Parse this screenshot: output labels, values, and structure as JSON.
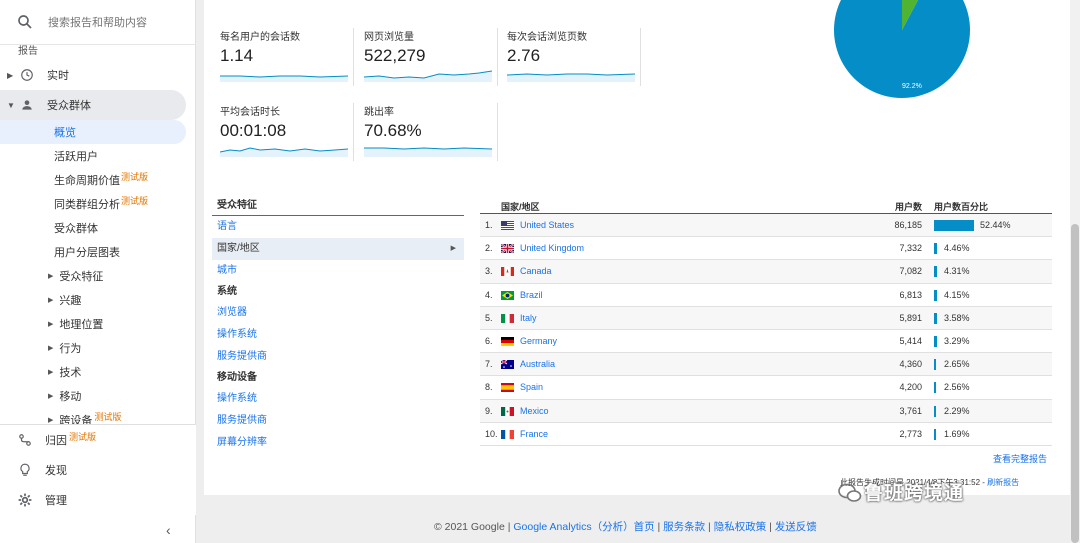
{
  "sidebar": {
    "search_placeholder": "搜索报告和帮助内容",
    "reports_label": "报告",
    "realtime": "实时",
    "audience": "受众群体",
    "audience_sub": [
      {
        "label": "概览",
        "active": true
      },
      {
        "label": "活跃用户"
      },
      {
        "label": "生命周期价值",
        "beta": "测试版"
      },
      {
        "label": "同类群组分析",
        "beta": "测试版"
      },
      {
        "label": "受众群体"
      },
      {
        "label": "用户分层图表"
      }
    ],
    "audience_sub2": [
      "受众特征",
      "兴趣",
      "地理位置",
      "行为",
      "技术",
      "移动",
      "跨设备"
    ],
    "cross_device_beta": "测试版",
    "attribution": "归因",
    "attribution_beta": "测试版",
    "discover": "发现",
    "admin": "管理"
  },
  "metrics": [
    {
      "label": "每名用户的会话数",
      "value": "1.14"
    },
    {
      "label": "网页浏览量",
      "value": "522,279"
    },
    {
      "label": "每次会话浏览页数",
      "value": "2.76"
    },
    {
      "label": "平均会话时长",
      "value": "00:01:08"
    },
    {
      "label": "跳出率",
      "value": "70.68%"
    }
  ],
  "pie": {
    "main_pct": 92.2,
    "main_label": "92.2%",
    "main_color": "#058dc7",
    "other_color": "#50b432"
  },
  "dimensions": {
    "demographics_header": "受众特征",
    "demographics": [
      "语言",
      "国家/地区",
      "城市"
    ],
    "system_header": "系统",
    "system": [
      "浏览器",
      "操作系统",
      "服务提供商"
    ],
    "mobile_header": "移动设备",
    "mobile": [
      "操作系统",
      "服务提供商",
      "屏幕分辨率"
    ]
  },
  "table": {
    "col_country": "国家/地区",
    "col_users": "用户数",
    "col_pct": "用户数百分比",
    "rows": [
      {
        "idx": "1.",
        "country": "United States",
        "users": "86,185",
        "pct": "52.44%",
        "p": 52.44,
        "flag": "us"
      },
      {
        "idx": "2.",
        "country": "United Kingdom",
        "users": "7,332",
        "pct": "4.46%",
        "p": 4.46,
        "flag": "gb"
      },
      {
        "idx": "3.",
        "country": "Canada",
        "users": "7,082",
        "pct": "4.31%",
        "p": 4.31,
        "flag": "ca"
      },
      {
        "idx": "4.",
        "country": "Brazil",
        "users": "6,813",
        "pct": "4.15%",
        "p": 4.15,
        "flag": "br"
      },
      {
        "idx": "5.",
        "country": "Italy",
        "users": "5,891",
        "pct": "3.58%",
        "p": 3.58,
        "flag": "it"
      },
      {
        "idx": "6.",
        "country": "Germany",
        "users": "5,414",
        "pct": "3.29%",
        "p": 3.29,
        "flag": "de"
      },
      {
        "idx": "7.",
        "country": "Australia",
        "users": "4,360",
        "pct": "2.65%",
        "p": 2.65,
        "flag": "au"
      },
      {
        "idx": "8.",
        "country": "Spain",
        "users": "4,200",
        "pct": "2.56%",
        "p": 2.56,
        "flag": "es"
      },
      {
        "idx": "9.",
        "country": "Mexico",
        "users": "3,761",
        "pct": "2.29%",
        "p": 2.29,
        "flag": "mx"
      },
      {
        "idx": "10.",
        "country": "France",
        "users": "2,773",
        "pct": "1.69%",
        "p": 1.69,
        "flag": "fr"
      }
    ],
    "full_report": "查看完整报告"
  },
  "generated": {
    "text": "此报告生成时间是 2021/4/8下午3:31:52 - ",
    "refresh": "刷新报告"
  },
  "footer": {
    "copyright": "© 2021 Google | ",
    "ga": "Google Analytics（分析）首页",
    "terms": "服务条款",
    "privacy": "隐私权政策",
    "feedback": "发送反馈",
    "sep": " | "
  },
  "watermark": "鲁班跨境通",
  "colors": {
    "accent": "#1a73e8",
    "bar": "#058dc7",
    "beta": "#e37400"
  }
}
